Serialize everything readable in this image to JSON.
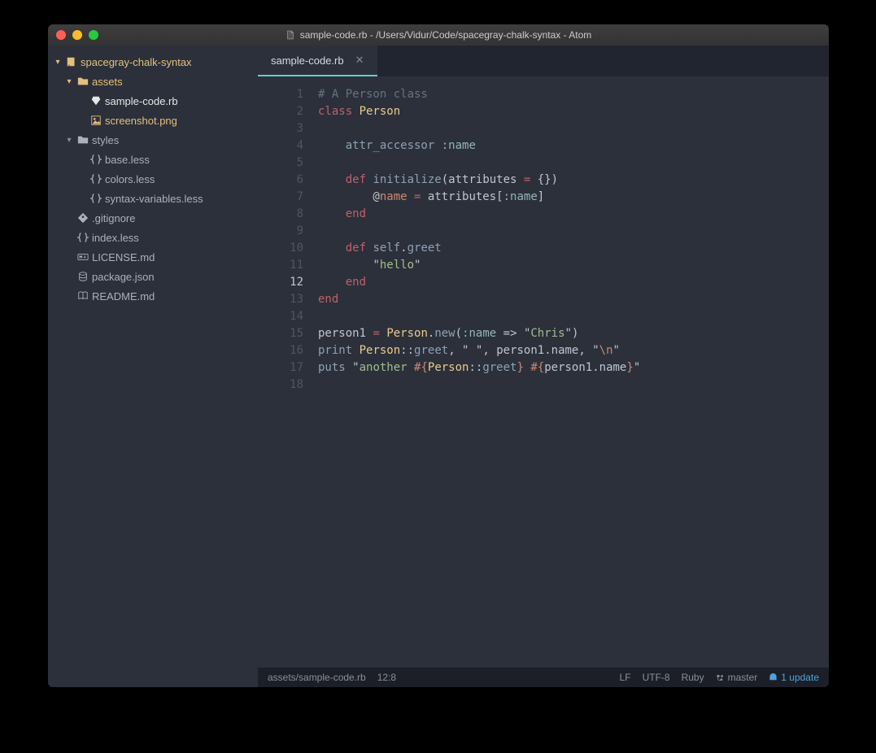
{
  "window": {
    "title": "sample-code.rb - /Users/Vidur/Code/spacegray-chalk-syntax - Atom"
  },
  "sidebar": {
    "root": "spacegray-chalk-syntax",
    "items": [
      {
        "label": "assets",
        "type": "folder",
        "open": true,
        "modified": true,
        "indent": 1
      },
      {
        "label": "sample-code.rb",
        "type": "ruby",
        "modified": false,
        "selected": true,
        "indent": 2
      },
      {
        "label": "screenshot.png",
        "type": "image",
        "modified": true,
        "indent": 2
      },
      {
        "label": "styles",
        "type": "folder",
        "open": true,
        "indent": 1
      },
      {
        "label": "base.less",
        "type": "css",
        "indent": 2
      },
      {
        "label": "colors.less",
        "type": "css",
        "indent": 2
      },
      {
        "label": "syntax-variables.less",
        "type": "css",
        "indent": 2
      },
      {
        "label": ".gitignore",
        "type": "git",
        "indent": 1
      },
      {
        "label": "index.less",
        "type": "css",
        "indent": 1
      },
      {
        "label": "LICENSE.md",
        "type": "md",
        "indent": 1
      },
      {
        "label": "package.json",
        "type": "json",
        "indent": 1
      },
      {
        "label": "README.md",
        "type": "book",
        "indent": 1
      }
    ]
  },
  "tab": {
    "label": "sample-code.rb"
  },
  "code": {
    "cursor_line": 12,
    "lines": [
      [
        {
          "t": "# A Person class",
          "c": "c-comment"
        }
      ],
      [
        {
          "t": "class ",
          "c": "c-kw"
        },
        {
          "t": "Person",
          "c": "c-class"
        }
      ],
      [],
      [
        {
          "t": "    ",
          "c": ""
        },
        {
          "t": "attr_accessor",
          "c": "c-func"
        },
        {
          "t": " ",
          "c": ""
        },
        {
          "t": ":name",
          "c": "c-sym"
        }
      ],
      [],
      [
        {
          "t": "    ",
          "c": ""
        },
        {
          "t": "def ",
          "c": "c-kw"
        },
        {
          "t": "initialize",
          "c": "c-func"
        },
        {
          "t": "(",
          "c": "c-punc"
        },
        {
          "t": "attributes ",
          "c": "c-punc"
        },
        {
          "t": "=",
          "c": "c-kw"
        },
        {
          "t": " {}",
          "c": "c-punc"
        },
        {
          "t": ")",
          "c": "c-punc"
        }
      ],
      [
        {
          "t": "        @",
          "c": "c-punc"
        },
        {
          "t": "name",
          "c": "c-var"
        },
        {
          "t": " ",
          "c": ""
        },
        {
          "t": "=",
          "c": "c-kw"
        },
        {
          "t": " attributes[",
          "c": "c-punc"
        },
        {
          "t": ":name",
          "c": "c-sym"
        },
        {
          "t": "]",
          "c": "c-punc"
        }
      ],
      [
        {
          "t": "    ",
          "c": ""
        },
        {
          "t": "end",
          "c": "c-kw"
        }
      ],
      [],
      [
        {
          "t": "    ",
          "c": ""
        },
        {
          "t": "def ",
          "c": "c-kw"
        },
        {
          "t": "self",
          "c": "c-func"
        },
        {
          "t": ".",
          "c": "c-punc"
        },
        {
          "t": "greet",
          "c": "c-func"
        }
      ],
      [
        {
          "t": "        ",
          "c": ""
        },
        {
          "t": "\"",
          "c": "c-punc"
        },
        {
          "t": "hello",
          "c": "c-str"
        },
        {
          "t": "\"",
          "c": "c-punc"
        }
      ],
      [
        {
          "t": "    ",
          "c": ""
        },
        {
          "t": "end",
          "c": "c-kw"
        }
      ],
      [
        {
          "t": "end",
          "c": "c-kw"
        }
      ],
      [],
      [
        {
          "t": "person1 ",
          "c": "c-punc"
        },
        {
          "t": "=",
          "c": "c-kw"
        },
        {
          "t": " ",
          "c": ""
        },
        {
          "t": "Person",
          "c": "c-class"
        },
        {
          "t": ".",
          "c": "c-punc"
        },
        {
          "t": "new",
          "c": "c-func"
        },
        {
          "t": "(",
          "c": "c-punc"
        },
        {
          "t": ":name",
          "c": "c-sym"
        },
        {
          "t": " => ",
          "c": "c-punc"
        },
        {
          "t": "\"",
          "c": "c-punc"
        },
        {
          "t": "Chris",
          "c": "c-str"
        },
        {
          "t": "\"",
          "c": "c-punc"
        },
        {
          "t": ")",
          "c": "c-punc"
        }
      ],
      [
        {
          "t": "print",
          "c": "c-func"
        },
        {
          "t": " ",
          "c": ""
        },
        {
          "t": "Person",
          "c": "c-class"
        },
        {
          "t": "::",
          "c": "c-punc"
        },
        {
          "t": "greet",
          "c": "c-func"
        },
        {
          "t": ", ",
          "c": "c-punc"
        },
        {
          "t": "\"",
          "c": "c-punc"
        },
        {
          "t": " ",
          "c": "c-str"
        },
        {
          "t": "\"",
          "c": "c-punc"
        },
        {
          "t": ", person1.name, ",
          "c": "c-punc"
        },
        {
          "t": "\"",
          "c": "c-punc"
        },
        {
          "t": "\\n",
          "c": "c-esc"
        },
        {
          "t": "\"",
          "c": "c-punc"
        }
      ],
      [
        {
          "t": "puts",
          "c": "c-func"
        },
        {
          "t": " ",
          "c": ""
        },
        {
          "t": "\"",
          "c": "c-punc"
        },
        {
          "t": "another ",
          "c": "c-str"
        },
        {
          "t": "#{",
          "c": "c-interp"
        },
        {
          "t": "Person",
          "c": "c-class"
        },
        {
          "t": "::",
          "c": "c-punc"
        },
        {
          "t": "greet",
          "c": "c-func"
        },
        {
          "t": "}",
          "c": "c-interp"
        },
        {
          "t": " ",
          "c": "c-str"
        },
        {
          "t": "#{",
          "c": "c-interp"
        },
        {
          "t": "person1.name",
          "c": "c-punc"
        },
        {
          "t": "}",
          "c": "c-interp"
        },
        {
          "t": "\"",
          "c": "c-punc"
        }
      ],
      []
    ]
  },
  "status": {
    "path": "assets/sample-code.rb",
    "cursor": "12:8",
    "eol": "LF",
    "encoding": "UTF-8",
    "grammar": "Ruby",
    "branch": "master",
    "update": "1 update"
  }
}
